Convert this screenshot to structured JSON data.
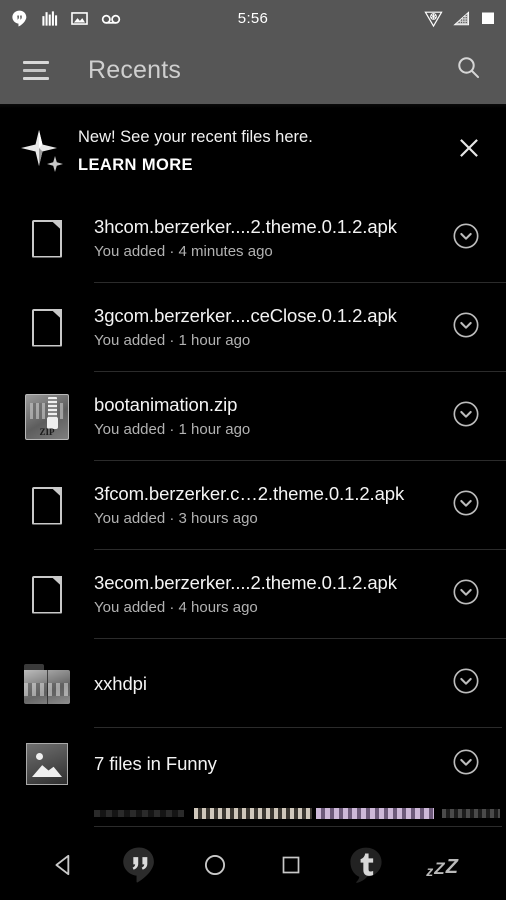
{
  "status_bar": {
    "time": "5:56",
    "left_icons": [
      {
        "name": "hangouts-icon"
      },
      {
        "name": "equalizer-icon"
      },
      {
        "name": "image-icon"
      },
      {
        "name": "voicemail-icon"
      }
    ],
    "right_icons": [
      {
        "name": "triquetra-icon"
      },
      {
        "name": "signal-strength-icon"
      },
      {
        "name": "battery-icon"
      }
    ]
  },
  "app_bar": {
    "menu_label": "menu",
    "title": "Recents",
    "search_label": "search"
  },
  "banner": {
    "title": "New! See your recent files here.",
    "cta": "LEARN MORE",
    "close_label": "close"
  },
  "file_list": {
    "items": [
      {
        "title": "3hcom.berzerker....2.theme.0.1.2.apk",
        "subtitle": "You added · 4 minutes ago",
        "thumb": "document-icon"
      },
      {
        "title": "3gcom.berzerker....ceClose.0.1.2.apk",
        "subtitle": "You added · 1 hour ago",
        "thumb": "document-icon"
      },
      {
        "title": "bootanimation.zip",
        "subtitle": "You added · 1 hour ago",
        "thumb": "zip-archive-thumbnail"
      },
      {
        "title": "3fcom.berzerker.c…2.theme.0.1.2.apk",
        "subtitle": "You added · 3 hours ago",
        "thumb": "document-icon"
      },
      {
        "title": "3ecom.berzerker....2.theme.0.1.2.apk",
        "subtitle": "You added · 4 hours ago",
        "thumb": "document-icon"
      },
      {
        "title": "xxhdpi",
        "subtitle": "",
        "thumb": "folder-thumbnail"
      },
      {
        "title": "7 files in Funny",
        "subtitle": "",
        "thumb": "image-thumbnail"
      }
    ],
    "expand_label": "expand"
  },
  "nav_bar": {
    "buttons": [
      {
        "name": "back-button"
      },
      {
        "name": "hangouts-button"
      },
      {
        "name": "home-button"
      },
      {
        "name": "recents-button"
      },
      {
        "name": "tumblr-button"
      },
      {
        "name": "sleep-button"
      }
    ],
    "sleep_glyphs": {
      "small": "z",
      "medium": "Z",
      "large": "Z"
    }
  },
  "colors": {
    "status_bar_bg": "#565656",
    "app_bar_bg": "#565656",
    "page_bg": "#000000",
    "primary_text": "#f4f4f4",
    "secondary_text": "#b2b2b2",
    "title_text": "#cfcfcf",
    "divider": "#2b2b2b"
  }
}
